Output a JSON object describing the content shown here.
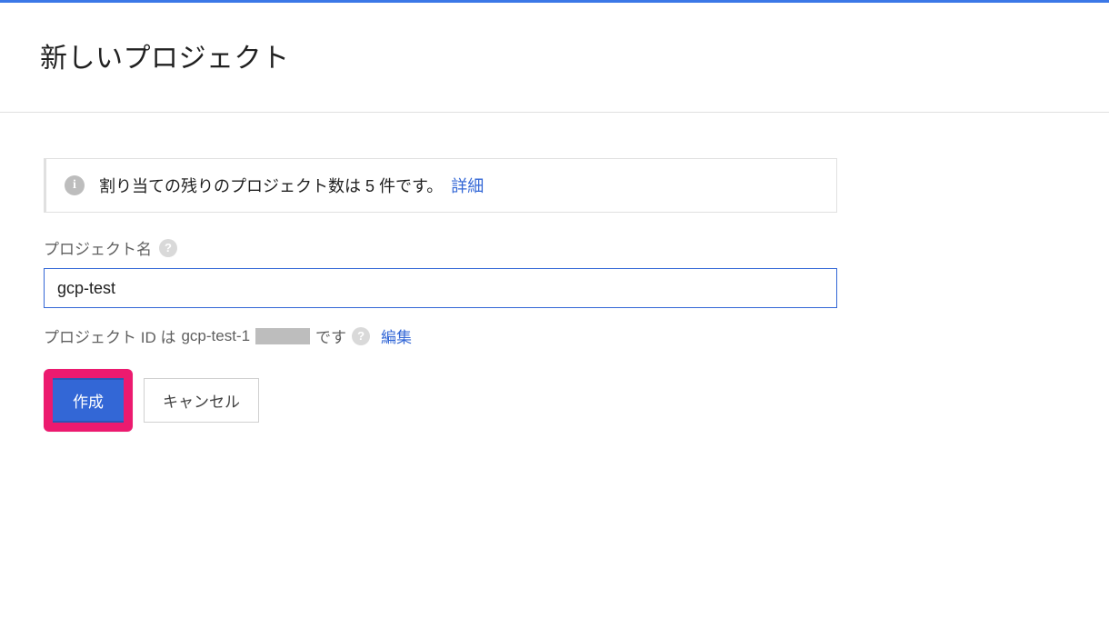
{
  "header": {
    "title": "新しいプロジェクト"
  },
  "quota": {
    "message": "割り当ての残りのプロジェクト数は 5 件です。",
    "detail_link": "詳細"
  },
  "form": {
    "project_name_label": "プロジェクト名",
    "project_name_value": "gcp-test",
    "project_id_prefix": "プロジェクト ID は",
    "project_id_value": "gcp-test-1",
    "project_id_suffix": "です",
    "edit_link": "編集"
  },
  "buttons": {
    "create": "作成",
    "cancel": "キャンセル"
  }
}
